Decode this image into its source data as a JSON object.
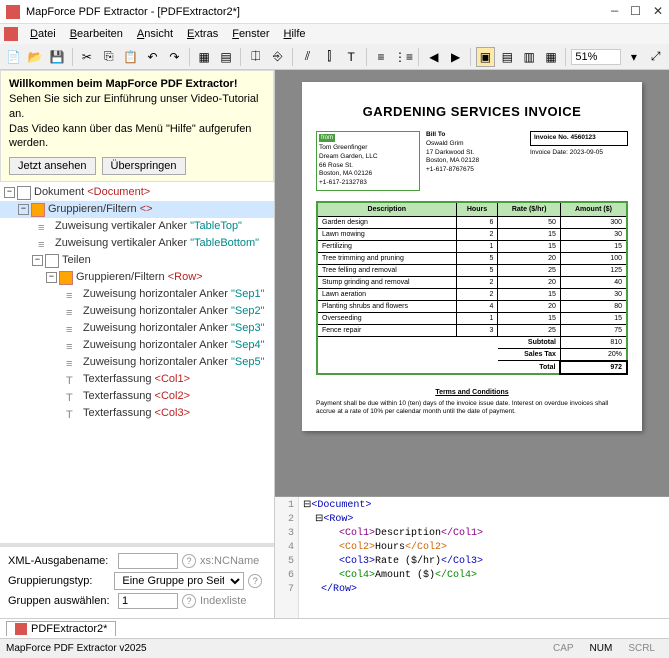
{
  "window": {
    "title": "MapForce PDF Extractor - [PDFExtractor2*]"
  },
  "menu": [
    "Datei",
    "Bearbeiten",
    "Ansicht",
    "Extras",
    "Fenster",
    "Hilfe"
  ],
  "zoom": "51%",
  "hint": {
    "title": "Willkommen beim MapForce PDF Extractor!",
    "l1": "Sehen Sie sich zur Einführung unser Video-Tutorial an.",
    "l2": "Das Video kann über das Menü \"Hilfe\" aufgerufen werden.",
    "btn1": "Jetzt ansehen",
    "btn2": "Überspringen"
  },
  "tree": {
    "doc": {
      "label": "Dokument",
      "tag": "<Document>"
    },
    "grp": {
      "label": "Gruppieren/Filtern",
      "tag": "<>"
    },
    "v1": {
      "label": "Zuweisung vertikaler Anker",
      "val": "\"TableTop\""
    },
    "v2": {
      "label": "Zuweisung vertikaler Anker",
      "val": "\"TableBottom\""
    },
    "teilen": "Teilen",
    "row": {
      "label": "Gruppieren/Filtern",
      "tag": "<Row>"
    },
    "h1": {
      "label": "Zuweisung horizontaler Anker",
      "val": "\"Sep1\""
    },
    "h2": {
      "label": "Zuweisung horizontaler Anker",
      "val": "\"Sep2\""
    },
    "h3": {
      "label": "Zuweisung horizontaler Anker",
      "val": "\"Sep3\""
    },
    "h4": {
      "label": "Zuweisung horizontaler Anker",
      "val": "\"Sep4\""
    },
    "h5": {
      "label": "Zuweisung horizontaler Anker",
      "val": "\"Sep5\""
    },
    "c1": {
      "label": "Texterfassung",
      "tag": "<Col1>"
    },
    "c2": {
      "label": "Texterfassung",
      "tag": "<Col2>"
    },
    "c3": {
      "label": "Texterfassung",
      "tag": "<Col3>"
    }
  },
  "props": {
    "label1": "XML-Ausgabename:",
    "val1": "",
    "hint1": "xs:NCName",
    "label2": "Gruppierungstyp:",
    "val2": "Eine Gruppe pro Seite",
    "label3": "Gruppen auswählen:",
    "val3": "1",
    "hint3": "Indexliste"
  },
  "invoice": {
    "title": "GARDENING SERVICES INVOICE",
    "fromLabel": "from",
    "fromLines": [
      "Tom Greenfinger",
      "Dream Garden, LLC",
      "66 Rose St.",
      "Boston, MA 02126",
      "+1-617-2132783"
    ],
    "billLabel": "Bill To",
    "billLines": [
      "Oswald Grim",
      "17 Darkwood St.",
      "Boston, MA 02128",
      "+1-617-8767675"
    ],
    "invNo": "Invoice No. 4560123",
    "invDate": "Invoice Date: 2023-09-05",
    "headers": [
      "Description",
      "Hours",
      "Rate ($/hr)",
      "Amount ($)"
    ],
    "rows": [
      [
        "Garden design",
        "6",
        "50",
        "300"
      ],
      [
        "Lawn mowing",
        "2",
        "15",
        "30"
      ],
      [
        "Fertilizing",
        "1",
        "15",
        "15"
      ],
      [
        "Tree trimming and pruning",
        "5",
        "20",
        "100"
      ],
      [
        "Tree felling and removal",
        "5",
        "25",
        "125"
      ],
      [
        "Stump grinding and removal",
        "2",
        "20",
        "40"
      ],
      [
        "Lawn aeration",
        "2",
        "15",
        "30"
      ],
      [
        "Planting shrubs and flowers",
        "4",
        "20",
        "80"
      ],
      [
        "Overseeding",
        "1",
        "15",
        "15"
      ],
      [
        "Fence repair",
        "3",
        "25",
        "75"
      ]
    ],
    "subtotalL": "Subtotal",
    "subtotal": "810",
    "taxL": "Sales Tax",
    "tax": "20%",
    "totalL": "Total",
    "total": "972",
    "termsTitle": "Terms and Conditions",
    "termsBody": "Payment shall be due within 10 (ten) days of the invoice issue date. Interest on overdue invoices shall accrue at a rate of 10% per calendar month until the date of payment."
  },
  "code": {
    "lines": [
      "1",
      "2",
      "3",
      "4",
      "5",
      "6",
      "7"
    ],
    "l1a": "<Document>",
    "l2a": "<Row>",
    "l3a": "<Col1>",
    "l3b": "Description",
    "l3c": "</Col1>",
    "l4a": "<Col2>",
    "l4b": "Hours",
    "l4c": "</Col2>",
    "l5a": "<Col3>",
    "l5b": "Rate ($/hr)",
    "l5c": "</Col3>",
    "l6a": "<Col4>",
    "l6b": "Amount ($)",
    "l6c": "</Col4>",
    "l7a": "</Row>"
  },
  "filetab": "PDFExtractor2*",
  "status": {
    "app": "MapForce PDF Extractor v2025",
    "cap": "CAP",
    "num": "NUM",
    "scrl": "SCRL"
  }
}
